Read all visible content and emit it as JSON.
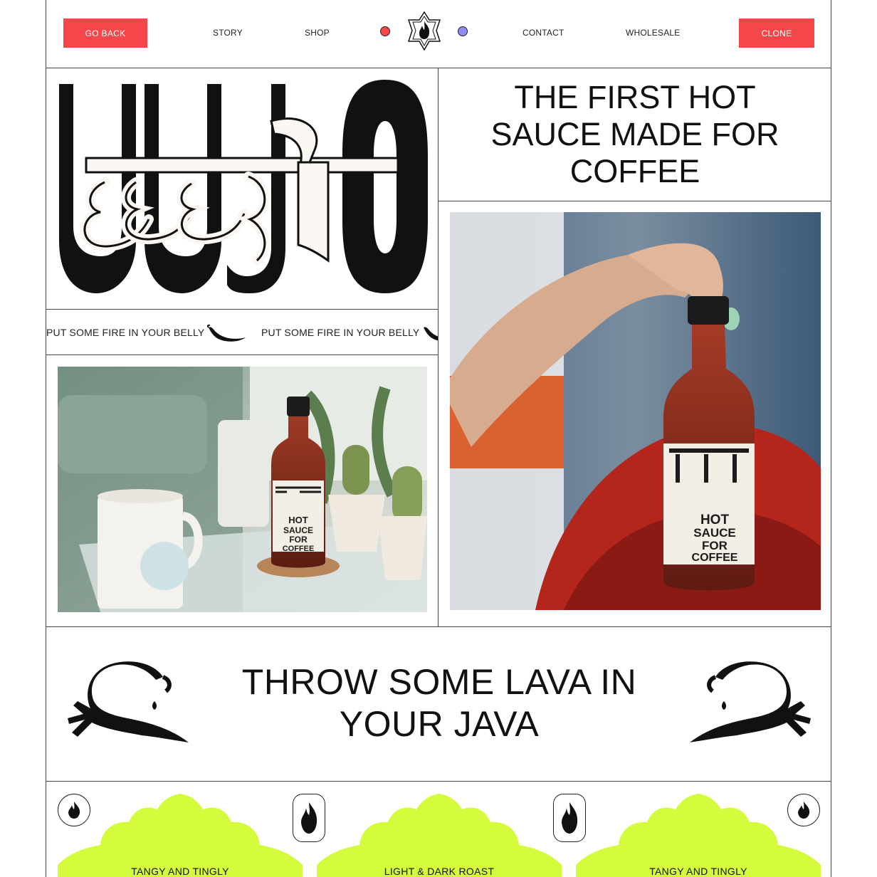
{
  "nav": {
    "go_back": "GO BACK",
    "links": [
      "STORY",
      "SHOP",
      "CONTACT",
      "WHOLESALE"
    ],
    "clone": "CLONE",
    "dot_colors": [
      "#f5474a",
      "#8e8cf0"
    ],
    "logo_icon": "flame-star-icon"
  },
  "hero": {
    "headline": "THE FIRST HOT SAUCE MADE FOR COFFEE",
    "ticker": [
      "PUT SOME FIRE IN YOUR BELLY",
      "PUT SOME FIRE IN YOUR BELLY"
    ],
    "bottle_label": {
      "line1": "HOT",
      "line2": "SAUCE",
      "line3": "FOR",
      "line4": "COFFEE"
    }
  },
  "lava": {
    "text": "THROW SOME LAVA IN YOUR JAVA"
  },
  "products": [
    {
      "label": "TANGY AND TINGLY"
    },
    {
      "label": "LIGHT & DARK ROAST"
    },
    {
      "label": "TANGY AND TINGLY"
    }
  ],
  "colors": {
    "accent_red": "#f5474a",
    "accent_lime": "#d4fc3c",
    "accent_violet": "#8e8cf0"
  }
}
